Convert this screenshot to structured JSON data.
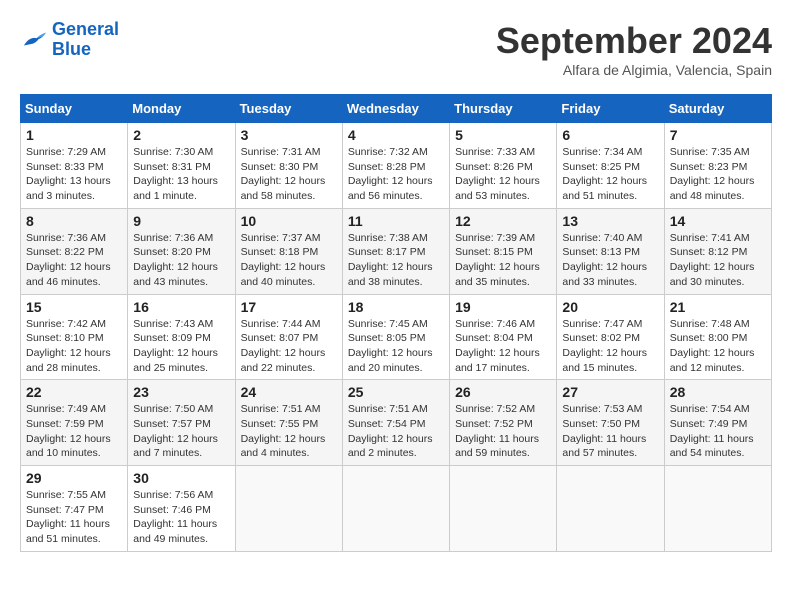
{
  "logo": {
    "line1": "General",
    "line2": "Blue"
  },
  "title": "September 2024",
  "location": "Alfara de Algimia, Valencia, Spain",
  "weekdays": [
    "Sunday",
    "Monday",
    "Tuesday",
    "Wednesday",
    "Thursday",
    "Friday",
    "Saturday"
  ],
  "weeks": [
    [
      {
        "day": "1",
        "sunrise": "Sunrise: 7:29 AM",
        "sunset": "Sunset: 8:33 PM",
        "daylight": "Daylight: 13 hours and 3 minutes."
      },
      {
        "day": "2",
        "sunrise": "Sunrise: 7:30 AM",
        "sunset": "Sunset: 8:31 PM",
        "daylight": "Daylight: 13 hours and 1 minute."
      },
      {
        "day": "3",
        "sunrise": "Sunrise: 7:31 AM",
        "sunset": "Sunset: 8:30 PM",
        "daylight": "Daylight: 12 hours and 58 minutes."
      },
      {
        "day": "4",
        "sunrise": "Sunrise: 7:32 AM",
        "sunset": "Sunset: 8:28 PM",
        "daylight": "Daylight: 12 hours and 56 minutes."
      },
      {
        "day": "5",
        "sunrise": "Sunrise: 7:33 AM",
        "sunset": "Sunset: 8:26 PM",
        "daylight": "Daylight: 12 hours and 53 minutes."
      },
      {
        "day": "6",
        "sunrise": "Sunrise: 7:34 AM",
        "sunset": "Sunset: 8:25 PM",
        "daylight": "Daylight: 12 hours and 51 minutes."
      },
      {
        "day": "7",
        "sunrise": "Sunrise: 7:35 AM",
        "sunset": "Sunset: 8:23 PM",
        "daylight": "Daylight: 12 hours and 48 minutes."
      }
    ],
    [
      {
        "day": "8",
        "sunrise": "Sunrise: 7:36 AM",
        "sunset": "Sunset: 8:22 PM",
        "daylight": "Daylight: 12 hours and 46 minutes."
      },
      {
        "day": "9",
        "sunrise": "Sunrise: 7:36 AM",
        "sunset": "Sunset: 8:20 PM",
        "daylight": "Daylight: 12 hours and 43 minutes."
      },
      {
        "day": "10",
        "sunrise": "Sunrise: 7:37 AM",
        "sunset": "Sunset: 8:18 PM",
        "daylight": "Daylight: 12 hours and 40 minutes."
      },
      {
        "day": "11",
        "sunrise": "Sunrise: 7:38 AM",
        "sunset": "Sunset: 8:17 PM",
        "daylight": "Daylight: 12 hours and 38 minutes."
      },
      {
        "day": "12",
        "sunrise": "Sunrise: 7:39 AM",
        "sunset": "Sunset: 8:15 PM",
        "daylight": "Daylight: 12 hours and 35 minutes."
      },
      {
        "day": "13",
        "sunrise": "Sunrise: 7:40 AM",
        "sunset": "Sunset: 8:13 PM",
        "daylight": "Daylight: 12 hours and 33 minutes."
      },
      {
        "day": "14",
        "sunrise": "Sunrise: 7:41 AM",
        "sunset": "Sunset: 8:12 PM",
        "daylight": "Daylight: 12 hours and 30 minutes."
      }
    ],
    [
      {
        "day": "15",
        "sunrise": "Sunrise: 7:42 AM",
        "sunset": "Sunset: 8:10 PM",
        "daylight": "Daylight: 12 hours and 28 minutes."
      },
      {
        "day": "16",
        "sunrise": "Sunrise: 7:43 AM",
        "sunset": "Sunset: 8:09 PM",
        "daylight": "Daylight: 12 hours and 25 minutes."
      },
      {
        "day": "17",
        "sunrise": "Sunrise: 7:44 AM",
        "sunset": "Sunset: 8:07 PM",
        "daylight": "Daylight: 12 hours and 22 minutes."
      },
      {
        "day": "18",
        "sunrise": "Sunrise: 7:45 AM",
        "sunset": "Sunset: 8:05 PM",
        "daylight": "Daylight: 12 hours and 20 minutes."
      },
      {
        "day": "19",
        "sunrise": "Sunrise: 7:46 AM",
        "sunset": "Sunset: 8:04 PM",
        "daylight": "Daylight: 12 hours and 17 minutes."
      },
      {
        "day": "20",
        "sunrise": "Sunrise: 7:47 AM",
        "sunset": "Sunset: 8:02 PM",
        "daylight": "Daylight: 12 hours and 15 minutes."
      },
      {
        "day": "21",
        "sunrise": "Sunrise: 7:48 AM",
        "sunset": "Sunset: 8:00 PM",
        "daylight": "Daylight: 12 hours and 12 minutes."
      }
    ],
    [
      {
        "day": "22",
        "sunrise": "Sunrise: 7:49 AM",
        "sunset": "Sunset: 7:59 PM",
        "daylight": "Daylight: 12 hours and 10 minutes."
      },
      {
        "day": "23",
        "sunrise": "Sunrise: 7:50 AM",
        "sunset": "Sunset: 7:57 PM",
        "daylight": "Daylight: 12 hours and 7 minutes."
      },
      {
        "day": "24",
        "sunrise": "Sunrise: 7:51 AM",
        "sunset": "Sunset: 7:55 PM",
        "daylight": "Daylight: 12 hours and 4 minutes."
      },
      {
        "day": "25",
        "sunrise": "Sunrise: 7:51 AM",
        "sunset": "Sunset: 7:54 PM",
        "daylight": "Daylight: 12 hours and 2 minutes."
      },
      {
        "day": "26",
        "sunrise": "Sunrise: 7:52 AM",
        "sunset": "Sunset: 7:52 PM",
        "daylight": "Daylight: 11 hours and 59 minutes."
      },
      {
        "day": "27",
        "sunrise": "Sunrise: 7:53 AM",
        "sunset": "Sunset: 7:50 PM",
        "daylight": "Daylight: 11 hours and 57 minutes."
      },
      {
        "day": "28",
        "sunrise": "Sunrise: 7:54 AM",
        "sunset": "Sunset: 7:49 PM",
        "daylight": "Daylight: 11 hours and 54 minutes."
      }
    ],
    [
      {
        "day": "29",
        "sunrise": "Sunrise: 7:55 AM",
        "sunset": "Sunset: 7:47 PM",
        "daylight": "Daylight: 11 hours and 51 minutes."
      },
      {
        "day": "30",
        "sunrise": "Sunrise: 7:56 AM",
        "sunset": "Sunset: 7:46 PM",
        "daylight": "Daylight: 11 hours and 49 minutes."
      },
      null,
      null,
      null,
      null,
      null
    ]
  ]
}
